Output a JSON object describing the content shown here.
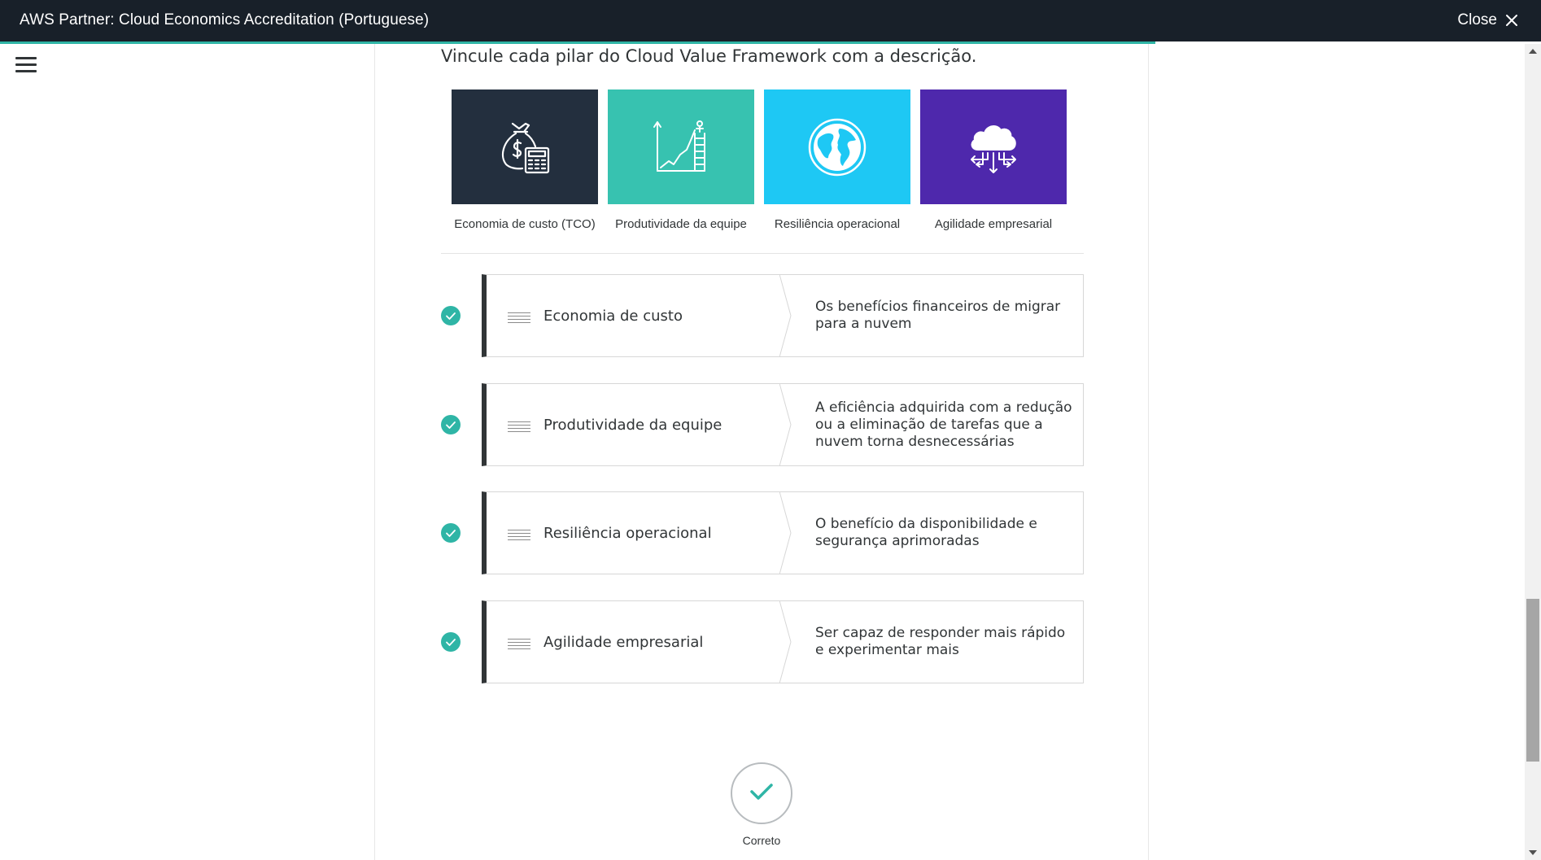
{
  "header": {
    "title": "AWS Partner: Cloud Economics Accreditation (Portuguese)",
    "close_label": "Close",
    "close_icon": "close-icon"
  },
  "colors": {
    "header_bg": "#182029",
    "accent": "#2fb5a6",
    "tile_tco": "#232f3e",
    "tile_productivity": "#37c2b0",
    "tile_resilience": "#1ec8f4",
    "tile_agility": "#4e28ac"
  },
  "question": "Vincule cada pilar do Cloud Value Framework com a descrição.",
  "tiles": [
    {
      "icon": "money-bag-calculator-icon",
      "caption": "Economia de custo (TCO)"
    },
    {
      "icon": "growth-chart-ladder-icon",
      "caption": "Produtividade da equipe"
    },
    {
      "icon": "globe-icon",
      "caption": "Resiliência operacional"
    },
    {
      "icon": "cloud-network-icon",
      "caption": "Agilidade empresarial"
    }
  ],
  "pairs": [
    {
      "term": "Economia de custo",
      "description": "Os benefícios financeiros de migrar para a nuvem",
      "status": "correct"
    },
    {
      "term": "Produtividade da equipe",
      "description": "A eficiência adquirida com a redução ou a eliminação de tarefas que a nuvem torna desnecessárias",
      "status": "correct"
    },
    {
      "term": "Resiliência operacional",
      "description": "O benefício da disponibilidade e segurança aprimoradas",
      "status": "correct"
    },
    {
      "term": "Agilidade empresarial",
      "description": "Ser capaz de responder mais rápido e experimentar mais",
      "status": "correct"
    }
  ],
  "result": {
    "label": "Correto",
    "icon": "checkmark-icon"
  }
}
